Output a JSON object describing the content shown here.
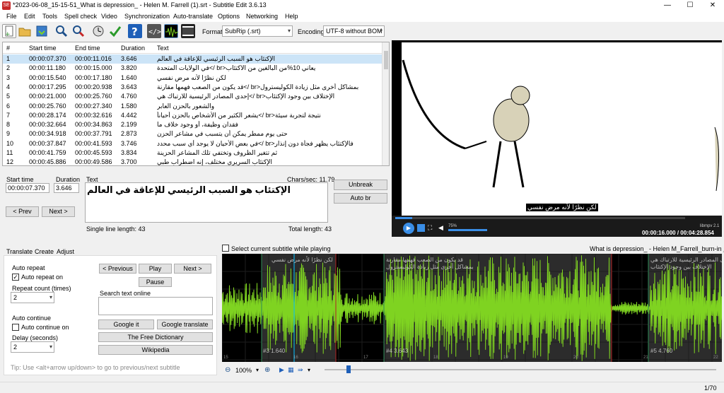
{
  "window": {
    "title": "*2023-06-08_15-15-51_What is depression_ - Helen M. Farrell (1).srt - Subtitle Edit 3.6.13",
    "app_icon": "SE",
    "minimize": "—",
    "maximize": "☐",
    "close": "✕"
  },
  "menu": [
    "File",
    "Edit",
    "Tools",
    "Spell check",
    "Video",
    "Synchronization",
    "Auto-translate",
    "Options",
    "Networking",
    "Help"
  ],
  "toolbar": {
    "format_label": "Format",
    "format_value": "SubRip (.srt)",
    "encoding_label": "Encoding",
    "encoding_value": "UTF-8 without BOM",
    "icons": [
      "new-file-icon",
      "open-folder-icon",
      "save-icon",
      "find-icon",
      "replace-icon",
      "visual-sync-icon",
      "spell-check-icon",
      "help-icon",
      "source-view-icon",
      "waveform-icon",
      "video-toggle-icon"
    ]
  },
  "grid": {
    "columns": [
      "#",
      "Start time",
      "End time",
      "Duration",
      "Text"
    ],
    "rows": [
      [
        "1",
        "00:00:07.370",
        "00:00:11.016",
        "3.646",
        "الإكتئاب هو السبب الرئيسي للإعاقة في العالم"
      ],
      [
        "2",
        "00:00:11.180",
        "00:00:15.000",
        "3.820",
        "يعاني 10%من البالغين من الاكتئاب<br />في الولايات المتحدة"
      ],
      [
        "3",
        "00:00:15.540",
        "00:00:17.180",
        "1.640",
        "لكن نظرًا لأنه مرض نفسي"
      ],
      [
        "4",
        "00:00:17.295",
        "00:00:20.938",
        "3.643",
        "بمشاكل أخرى مثل زيادة الكوليسترول<br />قد يكون من الصعب فهمها مقارنة"
      ],
      [
        "5",
        "00:00:21.000",
        "00:00:25.760",
        "4.760",
        "الإختلاف بين وجود الإكتئاب<br />إحدى المصادر الرئيسية للارتباك هي"
      ],
      [
        "6",
        "00:00:25.760",
        "00:00:27.340",
        "1.580",
        "والشعور بالحزن العابر"
      ],
      [
        "7",
        "00:00:28.174",
        "00:00:32.616",
        "4.442",
        "نتيجة لتجربة سيئة<br />يشعر الكثير من الأشخاص بالحزن أحياناً"
      ],
      [
        "8",
        "00:00:32.664",
        "00:00:34.863",
        "2.199",
        "فقدان وظيفة، أو وجود خلاف ما"
      ],
      [
        "9",
        "00:00:34.918",
        "00:00:37.791",
        "2.873",
        "حتى يوم ممطر يمكن أن يتسبب في مشاعر الحزن"
      ],
      [
        "10",
        "00:00:37.847",
        "00:00:41.593",
        "3.746",
        "فالإكتئاب يظهر فجأة دون إنذار<br />في بعض الأحيان لا يوجد أي سبب محدد"
      ],
      [
        "11",
        "00:00:41.759",
        "00:00:45.593",
        "3.834",
        "ثم تتغير الظروف وتختفي تلك المشاعر الحزينة"
      ],
      [
        "12",
        "00:00:45.886",
        "00:00:49.586",
        "3.700",
        "الإكتئاب السريري مختلف، إنه اضطراب طبي"
      ]
    ]
  },
  "edit": {
    "start_time_label": "Start time",
    "start_time_value": "00:00:07.370",
    "duration_label": "Duration",
    "duration_value": "3.646",
    "text_label": "Text",
    "chars_sec": "Chars/sec: 11.79",
    "text_value": "الإكتئاب هو السبب الرئيسي للإعاقة في العالم",
    "unbreak": "Unbreak",
    "auto_br": "Auto br",
    "prev": "< Prev",
    "next": "Next >",
    "single_line_length": "Single line length: 43",
    "total_length": "Total length: 43"
  },
  "video": {
    "caption": "لكن نظرًا لأنه مرض نفسي",
    "time_display": "00:00:16.000 / 00:04:28.854",
    "volume": "75%",
    "speed": "libmpv 2.1"
  },
  "lower": {
    "tabs": [
      "Translate",
      "Create",
      "Adjust"
    ],
    "auto_repeat_label": "Auto repeat",
    "auto_repeat_on": "Auto repeat on",
    "repeat_count_label": "Repeat count (times)",
    "repeat_count_value": "2",
    "auto_continue_label": "Auto continue",
    "auto_continue_on": "Auto continue on",
    "delay_label": "Delay (seconds)",
    "delay_value": "2",
    "prev_btn": "< Previous",
    "play_btn": "Play",
    "next_btn": "Next >",
    "pause_btn": "Pause",
    "search_label": "Search text online",
    "google_it": "Google it",
    "google_translate": "Google translate",
    "free_dictionary": "The Free Dictionary",
    "wikipedia": "Wikipedia",
    "tip": "Tip: Use <alt+arrow up/down> to go to previous/next subtitle"
  },
  "waveform": {
    "select_current": "Select current subtitle while playing",
    "video_name": "What is depression_ - Helen M_Farrell_burn-in مترجم",
    "seg1_text": "لكن نظرًا لأنه مرض نفسي",
    "seg1_label": "#3  1.640",
    "seg2_text_a": "قد يكون من الصعب فهمها مقارنة",
    "seg2_text_b": "بمشاكل أخرى مثل زيادة الكوليسترول",
    "seg2_label": "#4  3.643",
    "seg3_text_a": "إحدى المصادر الرئيسية للارتباك هي",
    "seg3_text_b": "الإختلاف بين وجود الإكتئاب",
    "seg3_label": "#5  4.760",
    "ticks": [
      "15",
      "16",
      "17",
      "18",
      "19",
      "20",
      "21",
      "22"
    ],
    "zoom": "100%"
  },
  "status": {
    "position": "1/70"
  },
  "colors": {
    "wave": "#7fd321",
    "selected_row": "#cce4f7",
    "segment": "#2c2c2c"
  }
}
